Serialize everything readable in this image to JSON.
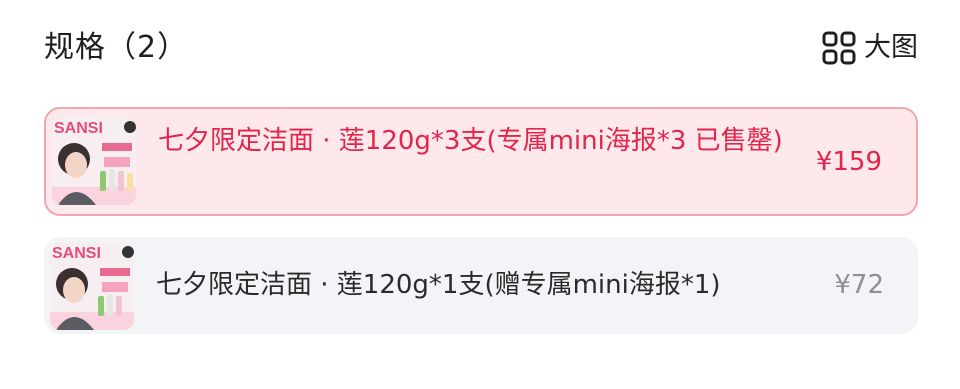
{
  "header": {
    "title": "规格（2）",
    "big_view_label": "大图",
    "big_view_icon": "grid-icon"
  },
  "options": [
    {
      "name": "七夕限定洁面 · 莲120g*3支(专属mini海报*3 已售罄)",
      "price": "¥159",
      "selected": true,
      "thumb_text": "SANSI"
    },
    {
      "name": "七夕限定洁面 · 莲120g*1支(赠专属mini海报*1)",
      "price": "¥72",
      "selected": false,
      "thumb_text": "SANSI"
    }
  ],
  "colors": {
    "selected_text": "#e3254b",
    "selected_bg": "#fde9ec",
    "selected_border": "#f2a6b0",
    "normal_bg": "#f3f4f8",
    "muted_price": "#8c8f99"
  }
}
